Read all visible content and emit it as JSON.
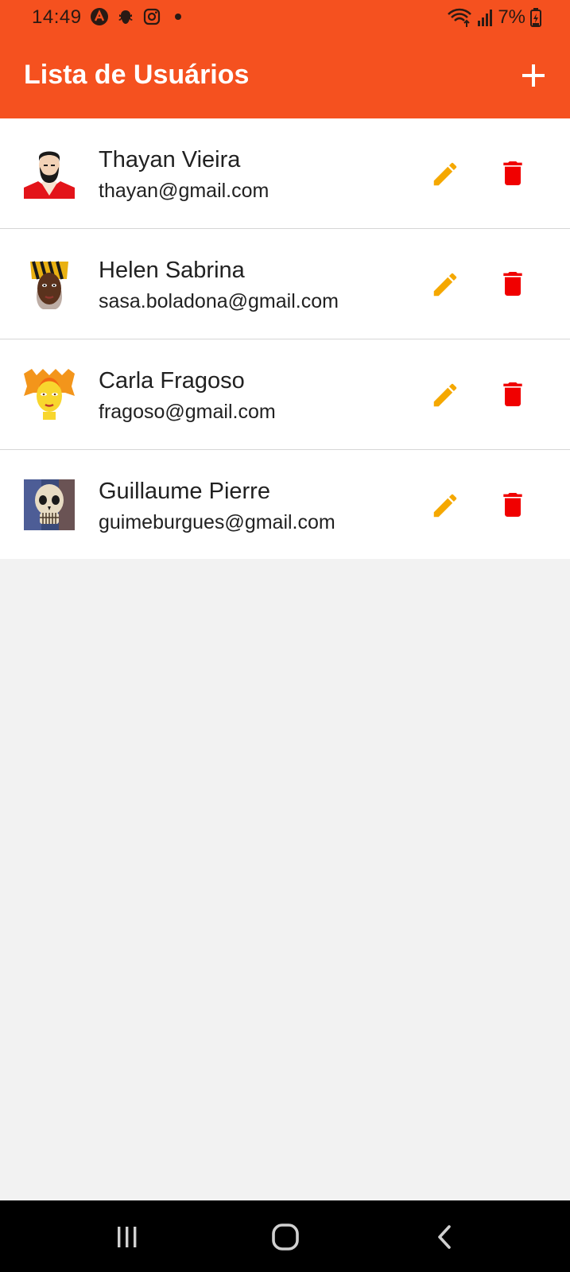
{
  "status_bar": {
    "time": "14:49",
    "battery": "7%",
    "icons": [
      "app-a-icon",
      "bug-icon",
      "instagram-icon",
      "dot-icon",
      "wifi-icon",
      "signal-icon",
      "battery-charging-icon"
    ]
  },
  "app_bar": {
    "title": "Lista de Usuários",
    "add_icon": "plus-icon",
    "background_color": "#f5511f"
  },
  "users": [
    {
      "name": "Thayan Vieira",
      "email": "thayan@gmail.com"
    },
    {
      "name": "Helen Sabrina",
      "email": "sasa.boladona@gmail.com"
    },
    {
      "name": "Carla Fragoso",
      "email": "fragoso@gmail.com"
    },
    {
      "name": "Guillaume Pierre",
      "email": "guimeburgues@gmail.com"
    }
  ],
  "actions": {
    "edit_icon": "pencil-icon",
    "edit_color": "#f5a800",
    "delete_icon": "trash-icon",
    "delete_color": "#f00000"
  },
  "nav_bar": {
    "items": [
      "recents-icon",
      "home-icon",
      "back-icon"
    ]
  }
}
